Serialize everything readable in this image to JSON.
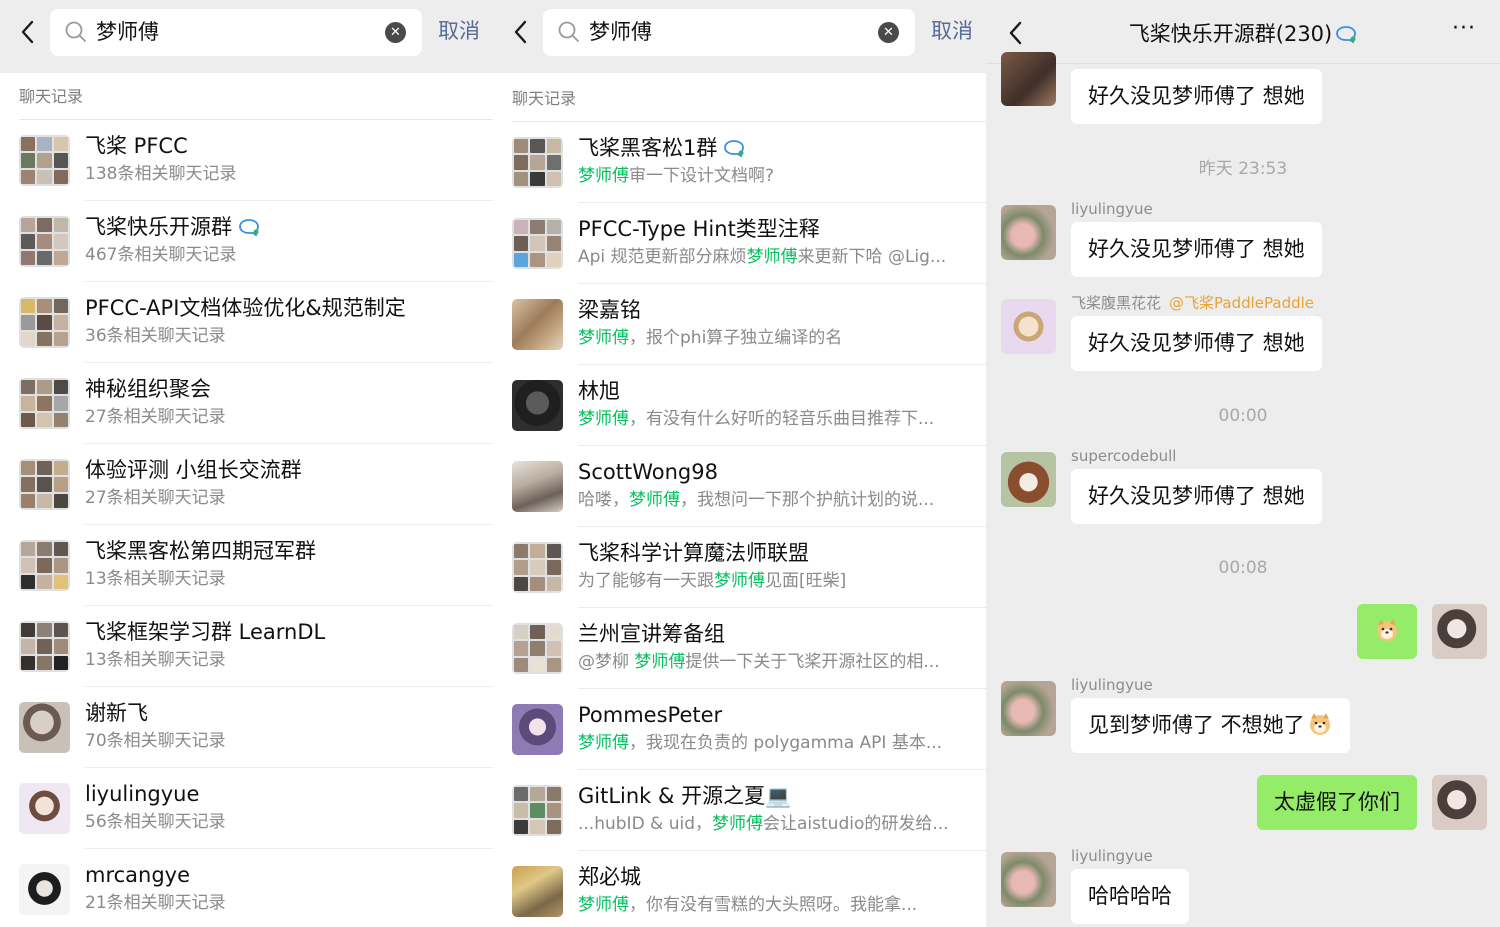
{
  "left_panel": {
    "query": "梦师傅",
    "cancel": "取消",
    "section_label": "聊天记录",
    "rows": [
      {
        "title": "飞桨 PFCC",
        "sub": "138条相关聊天记录"
      },
      {
        "title": "飞桨快乐开源群",
        "sub": "467条相关聊天记录"
      },
      {
        "title": "PFCC-API文档体验优化&规范制定",
        "sub": "36条相关聊天记录"
      },
      {
        "title": "神秘组织聚会",
        "sub": "27条相关聊天记录"
      },
      {
        "title": "体验评测 小组长交流群",
        "sub": "27条相关聊天记录"
      },
      {
        "title": "飞桨黑客松第四期冠军群",
        "sub": "13条相关聊天记录"
      },
      {
        "title": "飞桨框架学习群 LearnDL",
        "sub": "13条相关聊天记录"
      },
      {
        "title": "谢新飞",
        "sub": "70条相关聊天记录"
      },
      {
        "title": "liyulingyue",
        "sub": "56条相关聊天记录"
      },
      {
        "title": "mrcangye",
        "sub": "21条相关聊天记录"
      }
    ]
  },
  "middle_panel": {
    "query": "梦师傅",
    "cancel": "取消",
    "section_label": "聊天记录",
    "rows": [
      {
        "title": "飞桨黑客松1群",
        "pre": "",
        "hl": "梦师傅",
        "post": "审一下设计文档啊?"
      },
      {
        "title": "PFCC-Type Hint类型注释",
        "pre": "Api 规范更新部分麻烦",
        "hl": "梦师傅",
        "post": "来更新下哈 @Lig..."
      },
      {
        "title": "梁嘉铭",
        "pre": "",
        "hl": "梦师傅",
        "post": "，报个phi算子独立编译的名"
      },
      {
        "title": "林旭",
        "pre": "",
        "hl": "梦师傅",
        "post": "，有没有什么好听的轻音乐曲目推荐下..."
      },
      {
        "title": "ScottWong98",
        "pre": "哈喽，",
        "hl": "梦师傅",
        "post": "，我想问一下那个护航计划的说..."
      },
      {
        "title": "飞桨科学计算魔法师联盟",
        "pre": "为了能够有一天跟",
        "hl": "梦师傅",
        "post": "见面[旺柴]"
      },
      {
        "title": "兰州宣讲筹备组",
        "pre": "@梦柳 ",
        "hl": "梦师傅",
        "post": "提供一下关于飞桨开源社区的相..."
      },
      {
        "title": "PommesPeter",
        "pre": "",
        "hl": "梦师傅",
        "post": "，我现在负责的 polygamma API 基本..."
      },
      {
        "title": "GitLink & 开源之夏💻",
        "pre": "...hubID & uid，",
        "hl": "梦师傅",
        "post": "会让aistudio的研发给..."
      },
      {
        "title": "郑必城",
        "pre": "",
        "hl": "梦师傅",
        "post": "，你有没有雪糕的大头照呀。我能拿..."
      }
    ]
  },
  "chat_panel": {
    "title": "飞桨快乐开源群(230)",
    "more": "···",
    "messages": {
      "m0": "好久没见梦师傅了 想她",
      "t1": "昨天 23:53",
      "s1": "liyulingyue",
      "m1": "好久没见梦师傅了 想她",
      "s2": "飞桨腹黑花花",
      "s2_tag": "@飞桨PaddlePaddle",
      "m2": "好久没见梦师傅了 想她",
      "t2": "00:00",
      "s3": "supercodebull",
      "m3": "好久没见梦师傅了 想她",
      "t3": "00:08",
      "s5": "liyulingyue",
      "m5": "见到梦师傅了 不想她了",
      "m6": "太虚假了你们",
      "s7": "liyulingyue",
      "m7": "哈哈哈哈"
    }
  },
  "colors": {
    "link_blue": "#576b95",
    "highlight_green": "#07c160",
    "bubble_green": "#95ec69",
    "tag_orange": "#e8a23a"
  }
}
